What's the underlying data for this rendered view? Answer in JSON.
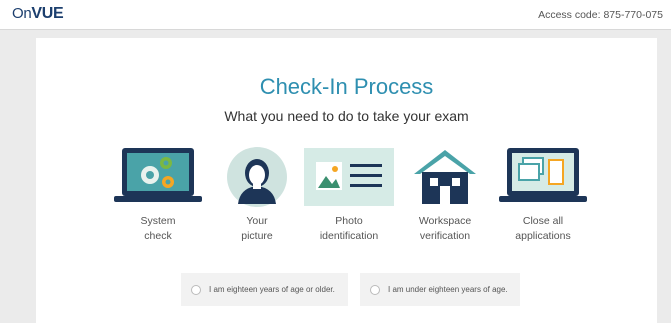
{
  "header": {
    "logo_text": "On",
    "logo_v": "VUE",
    "access_code": "Access code: 875-770-075"
  },
  "main": {
    "title": "Check-In Process",
    "subtitle": "What you need to do to take your exam",
    "steps": [
      {
        "label": "System\ncheck",
        "icon": "laptop-gears-icon"
      },
      {
        "label": "Your\npicture",
        "icon": "person-portrait-icon"
      },
      {
        "label": "Photo\nidentification",
        "icon": "id-card-icon"
      },
      {
        "label": "Workspace\nverification",
        "icon": "house-icon"
      },
      {
        "label": "Close all\napplications",
        "icon": "laptop-windows-icon"
      }
    ],
    "age_options": [
      "I am eighteen years of age or older.",
      "I am under eighteen years of age."
    ]
  },
  "colors": {
    "accent": "#2e8fb0",
    "brand_navy": "#1c3f6e",
    "icon_teal": "#4aa3a8",
    "icon_green": "#7bb842",
    "icon_orange": "#f5a623"
  }
}
